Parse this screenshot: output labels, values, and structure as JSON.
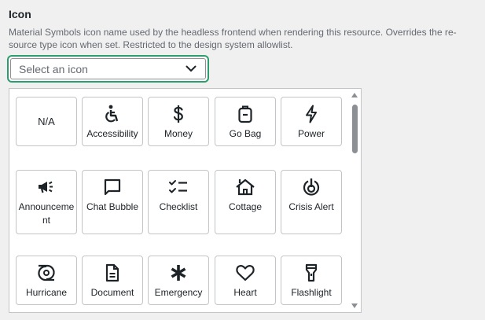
{
  "field": {
    "title": "Icon",
    "description": "Material Symbols icon name used by the headless frontend when rendering this resource. Overrides the re-source type icon when set. Restricted to the design system allowlist."
  },
  "select": {
    "placeholder": "Select an icon",
    "focus_color": "#2d9c6e"
  },
  "options": [
    {
      "label": "N/A",
      "icon": "none"
    },
    {
      "label": "Accessibility",
      "icon": "accessibility-icon"
    },
    {
      "label": "Money",
      "icon": "money-icon"
    },
    {
      "label": "Go Bag",
      "icon": "go-bag-icon"
    },
    {
      "label": "Power",
      "icon": "power-icon"
    },
    {
      "label": "Announcement",
      "icon": "announcement-icon"
    },
    {
      "label": "Chat Bubble",
      "icon": "chat-bubble-icon"
    },
    {
      "label": "Checklist",
      "icon": "checklist-icon"
    },
    {
      "label": "Cottage",
      "icon": "cottage-icon"
    },
    {
      "label": "Crisis Alert",
      "icon": "crisis-alert-icon"
    },
    {
      "label": "Hurricane",
      "icon": "hurricane-icon"
    },
    {
      "label": "Document",
      "icon": "document-icon"
    },
    {
      "label": "Emergency",
      "icon": "emergency-icon"
    },
    {
      "label": "Heart",
      "icon": "heart-icon"
    },
    {
      "label": "Flashlight",
      "icon": "flashlight-icon"
    }
  ]
}
